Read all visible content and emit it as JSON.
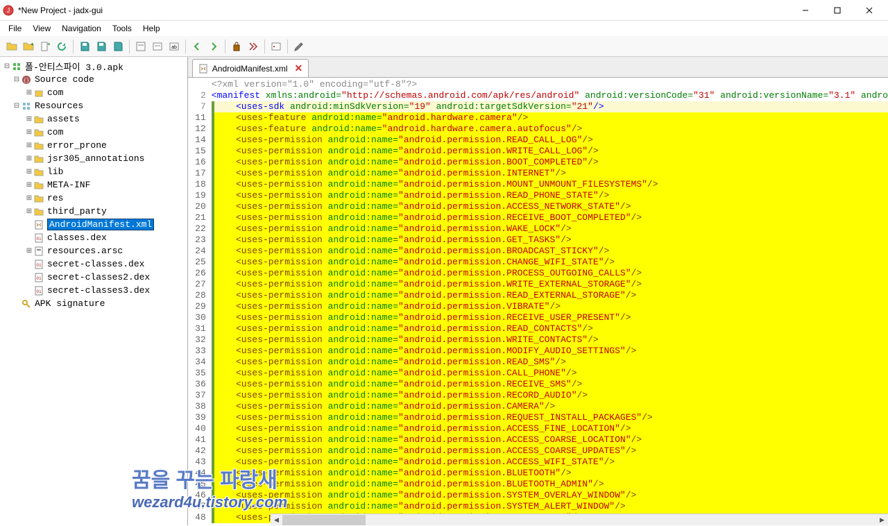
{
  "window": {
    "title": "*New Project - jadx-gui"
  },
  "menu": {
    "file": "File",
    "view": "View",
    "navigation": "Navigation",
    "tools": "Tools",
    "help": "Help"
  },
  "tree": {
    "root": "폴-안티스파이 3.0.apk",
    "source_code": "Source code",
    "sc_com": "com",
    "resources": "Resources",
    "res_items": [
      "assets",
      "com",
      "error_prone",
      "jsr305_annotations",
      "lib",
      "META-INF",
      "res",
      "third_party"
    ],
    "manifest": "AndroidManifest.xml",
    "classes_dex": "classes.dex",
    "resources_arsc": "resources.arsc",
    "secret1": "secret-classes.dex",
    "secret2": "secret-classes2.dex",
    "secret3": "secret-classes3.dex",
    "apk_sig": "APK signature"
  },
  "tab": {
    "label": "AndroidManifest.xml"
  },
  "code": {
    "l1": "<?xml version=\"1.0\" encoding=\"utf-8\"?>",
    "l2_n": "2",
    "manifest_open": "<manifest",
    "xmlns_attr": " xmlns:android=",
    "xmlns_val": "\"http://schemas.android.com/apk/res/android\"",
    "vcode_attr": " android:versionCode=",
    "vcode_val": "\"31\"",
    "vname_attr": " android:versionName=",
    "vname_val": "\"3.1\"",
    "andro_trail": " andro",
    "sdk_open": "<uses-sdk",
    "minsdk_attr": " android:minSdkVersion=",
    "minsdk_val": "\"19\"",
    "targetsdk_attr": " android:targetSdkVersion=",
    "targetsdk_val": "\"21\"",
    "close_self": "/>",
    "feat_open": "<uses-feature",
    "perm_open": "<uses-permission",
    "name_attr": " android:name=",
    "lines": [
      {
        "n": 7,
        "raw": "sdk"
      },
      {
        "n": 11,
        "tag": "feat",
        "v": "\"android.hardware.camera\""
      },
      {
        "n": 12,
        "tag": "feat",
        "v": "\"android.hardware.camera.autofocus\""
      },
      {
        "n": 14,
        "tag": "perm",
        "v": "\"android.permission.READ_CALL_LOG\""
      },
      {
        "n": 15,
        "tag": "perm",
        "v": "\"android.permission.WRITE_CALL_LOG\""
      },
      {
        "n": 16,
        "tag": "perm",
        "v": "\"android.permission.BOOT_COMPLETED\""
      },
      {
        "n": 17,
        "tag": "perm",
        "v": "\"android.permission.INTERNET\""
      },
      {
        "n": 18,
        "tag": "perm",
        "v": "\"android.permission.MOUNT_UNMOUNT_FILESYSTEMS\""
      },
      {
        "n": 19,
        "tag": "perm",
        "v": "\"android.permission.READ_PHONE_STATE\""
      },
      {
        "n": 20,
        "tag": "perm",
        "v": "\"android.permission.ACCESS_NETWORK_STATE\""
      },
      {
        "n": 21,
        "tag": "perm",
        "v": "\"android.permission.RECEIVE_BOOT_COMPLETED\""
      },
      {
        "n": 22,
        "tag": "perm",
        "v": "\"android.permission.WAKE_LOCK\""
      },
      {
        "n": 23,
        "tag": "perm",
        "v": "\"android.permission.GET_TASKS\""
      },
      {
        "n": 24,
        "tag": "perm",
        "v": "\"android.permission.BROADCAST_STICKY\""
      },
      {
        "n": 25,
        "tag": "perm",
        "v": "\"android.permission.CHANGE_WIFI_STATE\""
      },
      {
        "n": 26,
        "tag": "perm",
        "v": "\"android.permission.PROCESS_OUTGOING_CALLS\""
      },
      {
        "n": 27,
        "tag": "perm",
        "v": "\"android.permission.WRITE_EXTERNAL_STORAGE\""
      },
      {
        "n": 28,
        "tag": "perm",
        "v": "\"android.permission.READ_EXTERNAL_STORAGE\""
      },
      {
        "n": 29,
        "tag": "perm",
        "v": "\"android.permission.VIBRATE\""
      },
      {
        "n": 30,
        "tag": "perm",
        "v": "\"android.permission.RECEIVE_USER_PRESENT\""
      },
      {
        "n": 31,
        "tag": "perm",
        "v": "\"android.permission.READ_CONTACTS\""
      },
      {
        "n": 32,
        "tag": "perm",
        "v": "\"android.permission.WRITE_CONTACTS\""
      },
      {
        "n": 33,
        "tag": "perm",
        "v": "\"android.permission.MODIFY_AUDIO_SETTINGS\""
      },
      {
        "n": 34,
        "tag": "perm",
        "v": "\"android.permission.READ_SMS\""
      },
      {
        "n": 35,
        "tag": "perm",
        "v": "\"android.permission.CALL_PHONE\""
      },
      {
        "n": 36,
        "tag": "perm",
        "v": "\"android.permission.RECEIVE_SMS\""
      },
      {
        "n": 37,
        "tag": "perm",
        "v": "\"android.permission.RECORD_AUDIO\""
      },
      {
        "n": 38,
        "tag": "perm",
        "v": "\"android.permission.CAMERA\""
      },
      {
        "n": 39,
        "tag": "perm",
        "v": "\"android.permission.REQUEST_INSTALL_PACKAGES\""
      },
      {
        "n": 40,
        "tag": "perm",
        "v": "\"android.permission.ACCESS_FINE_LOCATION\""
      },
      {
        "n": 41,
        "tag": "perm",
        "v": "\"android.permission.ACCESS_COARSE_LOCATION\""
      },
      {
        "n": 42,
        "tag": "perm",
        "v": "\"android.permission.ACCESS_COARSE_UPDATES\""
      },
      {
        "n": 43,
        "tag": "perm",
        "v": "\"android.permission.ACCESS_WIFI_STATE\""
      },
      {
        "n": 44,
        "tag": "perm",
        "v": "\"android.permission.BLUETOOTH\""
      },
      {
        "n": 45,
        "tag": "perm",
        "v": "\"android.permission.BLUETOOTH_ADMIN\""
      },
      {
        "n": 46,
        "tag": "perm",
        "v": "\"android.permission.SYSTEM_OVERLAY_WINDOW\""
      },
      {
        "n": 47,
        "tag": "perm",
        "v": "\"android.permission.SYSTEM_ALERT_WINDOW\""
      },
      {
        "n": 48,
        "tag": "perm",
        "v": "\"android.permission.RECEIVE_MMS\""
      }
    ]
  },
  "watermark": {
    "line1": "꿈을 꾸는 파랑새",
    "line2": "wezard4u.tistory.com"
  }
}
